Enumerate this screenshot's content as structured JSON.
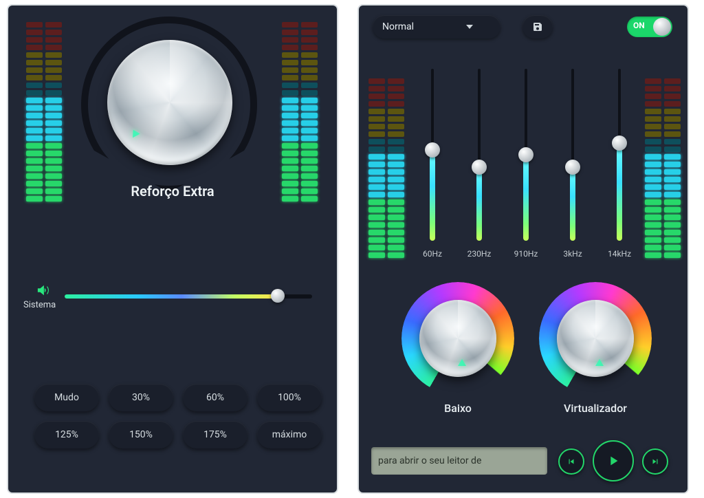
{
  "left": {
    "knob_label": "Reforço Extra",
    "slider_label": "Sistema",
    "slider_value_pct": 86,
    "presets": [
      "Mudo",
      "30%",
      "60%",
      "100%",
      "125%",
      "150%",
      "175%",
      "máximo"
    ]
  },
  "right": {
    "preset_dropdown": "Normal",
    "toggle_label": "ON",
    "toggle_state": true,
    "eq_bands": [
      {
        "label": "60Hz",
        "value": 0.53
      },
      {
        "label": "230Hz",
        "value": 0.43
      },
      {
        "label": "910Hz",
        "value": 0.5
      },
      {
        "label": "3kHz",
        "value": 0.43
      },
      {
        "label": "14kHz",
        "value": 0.57
      }
    ],
    "knob_bass_label": "Baixo",
    "knob_virt_label": "Virtualizador",
    "lcd_text": "para abrir o seu leitor de"
  },
  "colors": {
    "panel_bg": "#212735",
    "accent": "#23d66a"
  }
}
